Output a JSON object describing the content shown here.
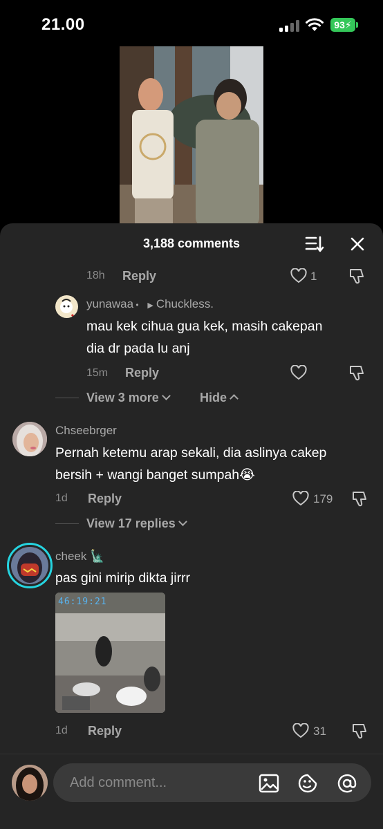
{
  "status_bar": {
    "time": "21.00",
    "battery": "93"
  },
  "panel": {
    "comment_count": "3,188 comments"
  },
  "thread_top": {
    "time": "18h",
    "reply": "Reply",
    "likes": "1"
  },
  "reply_1": {
    "username": "yunawaa",
    "replying_to": "Chuckless.",
    "text_line1": "mau kek cihua gua kek, masih cakepan",
    "text_line2": "dia dr pada lu anj",
    "time": "15m",
    "reply": "Reply"
  },
  "thread_controls_1": {
    "view_more": "View 3 more",
    "hide": "Hide"
  },
  "comment_2": {
    "username": "Chseebrger",
    "text_line1": "Pernah ketemu arap sekali, dia aslinya cakep",
    "text_line2": "bersih + wangi banget sumpah😭",
    "time": "1d",
    "reply": "Reply",
    "likes": "179",
    "view_replies": "View 17 replies"
  },
  "comment_3": {
    "username": "cheek 🗽",
    "text": "pas gini mirip dikta jirrr",
    "image_timestamp": "46:19:21",
    "time": "1d",
    "reply": "Reply",
    "likes": "31"
  },
  "input": {
    "placeholder": "Add comment..."
  },
  "colors": {
    "panel_bg": "#252525",
    "battery_green": "#34c759",
    "story_ring": "#25d4e0"
  }
}
